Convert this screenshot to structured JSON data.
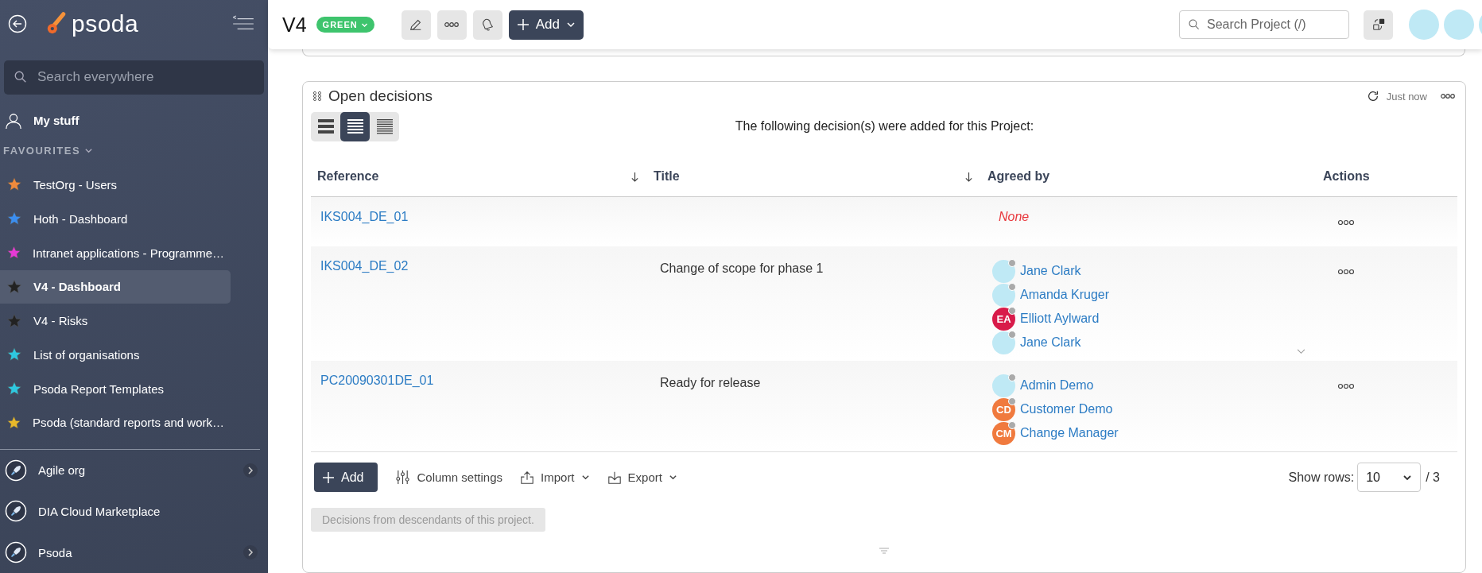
{
  "sidebar": {
    "logo": "psoda",
    "search": {
      "placeholder": "Search everywhere"
    },
    "my_stuff": "My stuff",
    "favourites_heading": "FAVOURITES",
    "favourites": [
      {
        "label": "TestOrg - Users",
        "color": "#f08a3c",
        "selected": false
      },
      {
        "label": "Hoth - Dashboard",
        "color": "#3b8ef0",
        "selected": false
      },
      {
        "label": "Intranet applications - Programme…",
        "color": "#e83ad6",
        "selected": false
      },
      {
        "label": "V4 - Dashboard",
        "color": "#222222",
        "selected": true
      },
      {
        "label": "V4 - Risks",
        "color": "#222222",
        "selected": false
      },
      {
        "label": "List of organisations",
        "color": "#2ec8e0",
        "selected": false
      },
      {
        "label": "Psoda Report Templates",
        "color": "#2ec8e0",
        "selected": false
      },
      {
        "label": "Psoda (standard reports and work…",
        "color": "#e8b92a",
        "selected": false
      }
    ],
    "organisations": [
      {
        "label": "Agile org",
        "has_children": true
      },
      {
        "label": "DIA Cloud Marketplace",
        "has_children": false
      },
      {
        "label": "Psoda",
        "has_children": true
      }
    ]
  },
  "topbar": {
    "title": "V4",
    "status": "GREEN",
    "add": "Add",
    "search": {
      "placeholder": "Search Project (/)"
    }
  },
  "panel": {
    "title": "Open decisions",
    "refreshed": "Just now",
    "intro": "The following decision(s) were added for this Project:",
    "view_modes": [
      {
        "selected": false
      },
      {
        "selected": true
      },
      {
        "selected": false
      }
    ],
    "columns": [
      {
        "label": "Reference",
        "sortable": true
      },
      {
        "label": "Title",
        "sortable": true
      },
      {
        "label": "Agreed by",
        "sortable": false
      },
      {
        "label": "Actions",
        "sortable": false
      }
    ],
    "rows": [
      {
        "reference": "IKS004_DE_01",
        "title": "",
        "agreed_by_none": "None",
        "expandable": false
      },
      {
        "reference": "IKS004_DE_02",
        "title": "Change of scope for phase 1",
        "expandable": true,
        "agreed_by": [
          {
            "name": "Jane Clark",
            "kind": "photo"
          },
          {
            "name": "Amanda Kruger",
            "kind": "photo"
          },
          {
            "name": "Elliott Aylward",
            "kind": "initials",
            "initials": "EA",
            "color": "#d81b4a"
          },
          {
            "name": "Jane Clark",
            "kind": "photo"
          }
        ]
      },
      {
        "reference": "PC20090301DE_01",
        "title": "Ready for release",
        "expandable": false,
        "agreed_by": [
          {
            "name": "Admin Demo",
            "kind": "photo"
          },
          {
            "name": "Customer Demo",
            "kind": "initials",
            "initials": "CD",
            "color": "#f07a3e"
          },
          {
            "name": "Change Manager",
            "kind": "initials",
            "initials": "CM",
            "color": "#f07a3e"
          }
        ]
      }
    ],
    "footer": {
      "add": "Add",
      "column_settings": "Column settings",
      "import": "Import",
      "export": "Export",
      "show_rows_label": "Show rows:",
      "show_rows_value": "10",
      "total": "/ 3",
      "descendants": "Decisions from descendants of this project."
    }
  }
}
